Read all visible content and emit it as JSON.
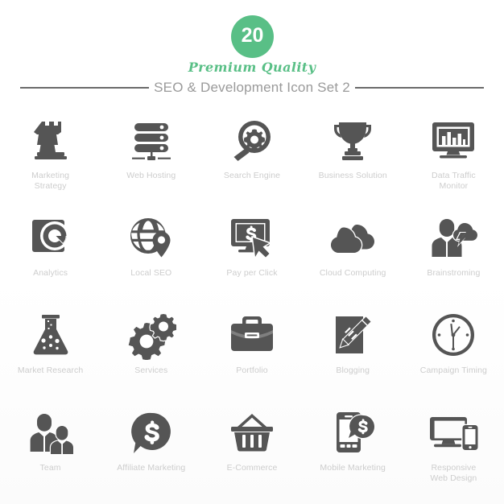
{
  "header": {
    "badge_number": "20",
    "premium_text": "Premium Quality",
    "set_title": "SEO & Development Icon Set 2",
    "accent_color": "#59bf86",
    "rule_color": "#6b6b6b",
    "title_color": "#9a9a9a"
  },
  "style": {
    "icon_color": "#555555",
    "caption_color": "#cdcdcd",
    "background": "#ffffff"
  },
  "icons": [
    {
      "label": "Marketing\nStrategy",
      "label_line1": "Marketing",
      "label_line2": "Strategy",
      "icon": "chess-rook-icon"
    },
    {
      "label": "Web Hosting",
      "label_line1": "Web Hosting",
      "label_line2": "",
      "icon": "server-stack-icon"
    },
    {
      "label": "Search Engine",
      "label_line1": "Search Engine",
      "label_line2": "",
      "icon": "magnifier-gear-icon"
    },
    {
      "label": "Business Solution",
      "label_line1": "Business Solution",
      "label_line2": "",
      "icon": "trophy-icon"
    },
    {
      "label": "Data Traffic\nMonitor",
      "label_line1": "Data Traffic",
      "label_line2": "Monitor",
      "icon": "monitor-bar-chart-icon"
    },
    {
      "label": "Analytics",
      "label_line1": "Analytics",
      "label_line2": "",
      "icon": "donut-chart-icon"
    },
    {
      "label": "Local SEO",
      "label_line1": "Local SEO",
      "label_line2": "",
      "icon": "globe-pin-icon"
    },
    {
      "label": "Pay per Click",
      "label_line1": "Pay per Click",
      "label_line2": "",
      "icon": "monitor-dollar-cursor-icon"
    },
    {
      "label": "Cloud Computing",
      "label_line1": "Cloud Computing",
      "label_line2": "",
      "icon": "clouds-icon"
    },
    {
      "label": "Brainstroming",
      "label_line1": "Brainstroming",
      "label_line2": "",
      "icon": "people-lightning-cloud-icon"
    },
    {
      "label": "Market Research",
      "label_line1": "Market Research",
      "label_line2": "",
      "icon": "flask-icon"
    },
    {
      "label": "Services",
      "label_line1": "Services",
      "label_line2": "",
      "icon": "gears-icon"
    },
    {
      "label": "Portfolio",
      "label_line1": "Portfolio",
      "label_line2": "",
      "icon": "briefcase-icon"
    },
    {
      "label": "Blogging",
      "label_line1": "Blogging",
      "label_line2": "",
      "icon": "pen-paper-icon"
    },
    {
      "label": "Campaign Timing",
      "label_line1": "Campaign Timing",
      "label_line2": "",
      "icon": "clock-icon"
    },
    {
      "label": "Team",
      "label_line1": "Team",
      "label_line2": "",
      "icon": "people-group-icon"
    },
    {
      "label": "Affiliate Marketing",
      "label_line1": "Affiliate Marketing",
      "label_line2": "",
      "icon": "speech-bubble-dollar-icon"
    },
    {
      "label": "E-Commerce",
      "label_line1": "E-Commerce",
      "label_line2": "",
      "icon": "shopping-basket-icon"
    },
    {
      "label": "Mobile Marketing",
      "label_line1": "Mobile Marketing",
      "label_line2": "",
      "icon": "phone-dollar-bubble-icon"
    },
    {
      "label": "Responsive\nWeb Design",
      "label_line1": "Responsive",
      "label_line2": "Web Design",
      "icon": "monitor-phone-icon"
    }
  ]
}
